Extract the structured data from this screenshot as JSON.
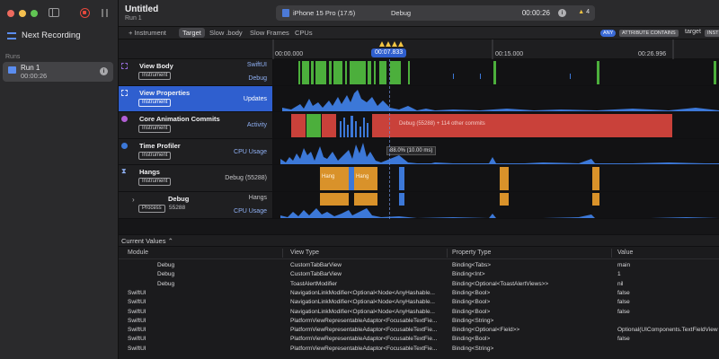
{
  "sidebar": {
    "next_recording": "Next Recording",
    "runs_label": "Runs",
    "run": {
      "title": "Run 1",
      "time": "00:00:26"
    }
  },
  "titlebar": {
    "title": "Untitled",
    "subtitle": "Run 1",
    "device": "iPhone 15 Pro (17.5)",
    "configuration": "Debug",
    "elapsed": "00:00:26",
    "warning_count": "4"
  },
  "filterbar": {
    "add_instrument": "+ Instrument",
    "tabs": [
      "Target",
      "Slow .body",
      "Slow Frames",
      "CPUs"
    ],
    "token_any": "ANY",
    "token_attribute": "ATTRIBUTE CONTAINS",
    "token_text": "target",
    "token_inst": "INST"
  },
  "ruler": {
    "ticks": [
      "00:00.000",
      "00:15.000",
      "00:26.996"
    ],
    "playhead": "00:07.833"
  },
  "tracks": [
    {
      "name": "View Body",
      "badge": "Instrument",
      "right1": "SwiftUI",
      "right2": "Debug"
    },
    {
      "name": "View Properties",
      "badge": "Instrument",
      "right1": "Updates"
    },
    {
      "name": "Core Animation Commits",
      "badge": "Instrument",
      "right1": "Activity",
      "overlay": "Debug (55288) + 114 other commits"
    },
    {
      "name": "Time Profiler",
      "badge": "Instrument",
      "right1": "CPU Usage",
      "overlay": "88.0% (10.00 ms)"
    },
    {
      "name": "Hangs",
      "badge": "Instrument",
      "right1": "Debug (55288)",
      "hang_label": "Hang"
    },
    {
      "name": "Debug",
      "badge": "Process",
      "pid": "55288",
      "right1": "Hangs",
      "right2": "CPU Usage"
    }
  ],
  "current_values": {
    "label": "Current Values",
    "columns": [
      "Module",
      "View Type",
      "Property Type",
      "Value"
    ],
    "rows": [
      [
        "Debug",
        "CustomTabBarView",
        "Binding<Tabs>",
        "main"
      ],
      [
        "Debug",
        "CustomTabBarView",
        "Binding<Int>",
        "1"
      ],
      [
        "Debug",
        "ToastAlertModifier",
        "Binding<Optional<ToastAlertViews>>",
        "nil"
      ],
      [
        "SwiftUI",
        "NavigationLinkModifier<Optional<Node<AnyHashable...",
        "Binding<Bool>",
        "false"
      ],
      [
        "SwiftUI",
        "NavigationLinkModifier<Optional<Node<AnyHashable...",
        "Binding<Bool>",
        "false"
      ],
      [
        "SwiftUI",
        "NavigationLinkModifier<Optional<Node<AnyHashable...",
        "Binding<Bool>",
        "false"
      ],
      [
        "SwiftUI",
        "PlatformViewRepresentableAdaptor<FocusableTextFie...",
        "Binding<String>",
        ""
      ],
      [
        "SwiftUI",
        "PlatformViewRepresentableAdaptor<FocusableTextFie...",
        "Binding<Optional<Field>>",
        "Optional(UIComponents.TextFieldView"
      ],
      [
        "SwiftUI",
        "PlatformViewRepresentableAdaptor<FocusableTextFie...",
        "Binding<Bool>",
        "false"
      ],
      [
        "SwiftUI",
        "PlatformViewRepresentableAdaptor<FocusableTextFie...",
        "Binding<String>",
        ""
      ]
    ]
  },
  "colors": {
    "accent": "#2f5fcf",
    "green": "#4caf3c",
    "red": "#c9413a",
    "blue": "#3c78d8",
    "orange": "#d9922a"
  }
}
